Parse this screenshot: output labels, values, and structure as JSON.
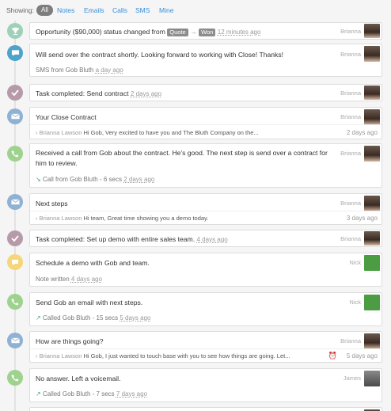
{
  "filter": {
    "showing_label": "Showing:",
    "options": [
      "All",
      "Notes",
      "Emails",
      "Calls",
      "SMS",
      "Mine"
    ]
  },
  "colors": {
    "opportunity": "#9fd0b9",
    "sms": "#4ea3c9",
    "task": "#b79aa8",
    "email": "#8fb1d3",
    "call": "#9ed28e",
    "note": "#f5d67a",
    "link": "#3a8fd6"
  },
  "activities": [
    {
      "type": "opportunity",
      "icon": "trophy-icon",
      "text_before": "Opportunity ($90,000) status changed from",
      "from_status": "Quote",
      "arrow": "→",
      "to_status": "Won",
      "time": "12 minutes ago",
      "user": "Brianna"
    },
    {
      "type": "sms",
      "icon": "chat-icon",
      "text": "Will send over the contract shortly. Looking forward to working with Close! Thanks!",
      "sub": "SMS from Gob Bluth",
      "time": "a day ago",
      "user": "Brianna"
    },
    {
      "type": "task",
      "icon": "check-icon",
      "text": "Task completed: Send contract",
      "time": "2 days ago",
      "user": "Brianna"
    },
    {
      "type": "email",
      "icon": "envelope-icon",
      "text": "Your Close Contract",
      "from": "Brianna Lawson",
      "preview": "Hi Gob, Very excited to have you and The Bluth Company on the...",
      "time": "2 days ago",
      "user": "Brianna"
    },
    {
      "type": "call",
      "icon": "phone-icon",
      "text": "Received a call from Gob about the contract. He's good. The next step is send over a contract for him to review.",
      "sub": "Call from Gob Bluth - 6 secs",
      "time": "2 days ago",
      "user": "Brianna"
    },
    {
      "type": "email",
      "icon": "envelope-icon",
      "text": "Next steps",
      "from": "Brianna Lawson",
      "preview": "Hi team, Great time showing you a demo today.",
      "time": "3 days ago",
      "user": "Brianna"
    },
    {
      "type": "task",
      "icon": "check-icon",
      "text": "Task completed: Set up demo with entire sales team.",
      "time": "4 days ago",
      "user": "Brianna"
    },
    {
      "type": "note",
      "icon": "note-icon",
      "text": "Schedule a demo with Gob and team.",
      "sub": "Note written",
      "time": "4 days ago",
      "user": "Nick"
    },
    {
      "type": "call",
      "icon": "phone-icon",
      "text": "Send Gob an email with next steps.",
      "sub": "Called Gob Bluth - 15 secs",
      "time": "5 days ago",
      "user": "Nick"
    },
    {
      "type": "email",
      "icon": "envelope-icon",
      "text": "How are things going?",
      "from": "Brianna Lawson",
      "preview": "Hi Gob, I just wanted to touch base with you to see how things are going. Let...",
      "time": "5 days ago",
      "user": "Brianna"
    },
    {
      "type": "call",
      "icon": "phone-icon",
      "text": "No answer. Left a voicemail.",
      "sub": "Called Gob Bluth - 7 secs",
      "time": "7 days ago",
      "user": "James"
    }
  ]
}
